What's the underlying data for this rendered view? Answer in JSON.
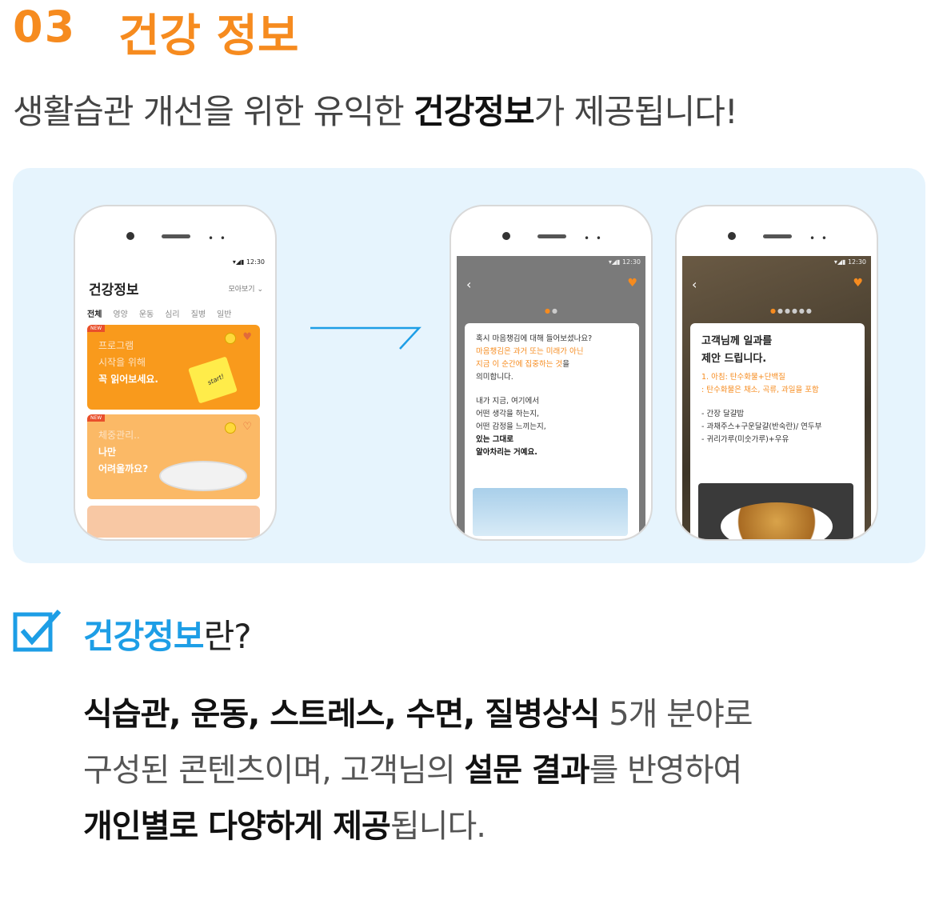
{
  "header": {
    "number": "03",
    "title": "건강 정보"
  },
  "subtitle": {
    "prefix": "생활습관 개선을 위한 유익한 ",
    "bold": "건강정보",
    "suffix": "가 제공됩니다!"
  },
  "phone1": {
    "time": "12:30",
    "app_title": "건강정보",
    "view_all": "모아보기 ⌄",
    "tabs": [
      "전체",
      "영양",
      "운동",
      "심리",
      "질병",
      "일반"
    ],
    "card1": {
      "badge": "NEW",
      "line1": "프로그램",
      "line2": "시작을 위해",
      "line3": "꼭 읽어보세요.",
      "note": "start!"
    },
    "card2": {
      "badge": "NEW",
      "line1": "체중관리..",
      "line2": "나만",
      "line3": "어려울까요?"
    }
  },
  "phone2": {
    "time": "12:30",
    "lines": [
      "혹시 마음챙김에 대해 들어보셨나요?",
      "마음챙김은 과거 또는 미래가 아닌",
      "지금 이 순간에 집중하는 것",
      "을",
      "의미합니다.",
      "내가 지금, 여기에서",
      "어떤 생각을 하는지,",
      "어떤 감정을 느끼는지,",
      "있는 그대로",
      "알아차리는 거예요."
    ]
  },
  "phone3": {
    "time": "12:30",
    "heading1": "고객님께 일과를",
    "heading2": "제안 드립니다.",
    "orange1": "1. 아침: 탄수화물+단백질",
    "orange2": ": 탄수화물은 채소, 곡류, 과일을 포함",
    "items": [
      "- 간장 달걀밥",
      "- 과채주스+구운달걀(반숙란)/ 연두부",
      "- 귀리가루(미숫가루)+우유"
    ]
  },
  "question": {
    "blue": "건강정보",
    "rest": "란?"
  },
  "description": {
    "bold1": "식습관, 운동, 스트레스, 수면, 질병상식",
    "text1": " 5개 분야로",
    "text2": "구성된 콘텐츠이며, 고객님의 ",
    "bold2": "설문 결과",
    "text3": "를 반영하여",
    "bold3": "개인별로 다양하게 제공",
    "text4": "됩니다."
  },
  "colors": {
    "accent": "#f68b1f",
    "blue": "#1d9ee6",
    "panel": "#e6f4fd"
  },
  "icons": [
    "checkbox-icon",
    "back-arrow-icon",
    "heart-icon",
    "coin-icon",
    "camera-icon"
  ]
}
